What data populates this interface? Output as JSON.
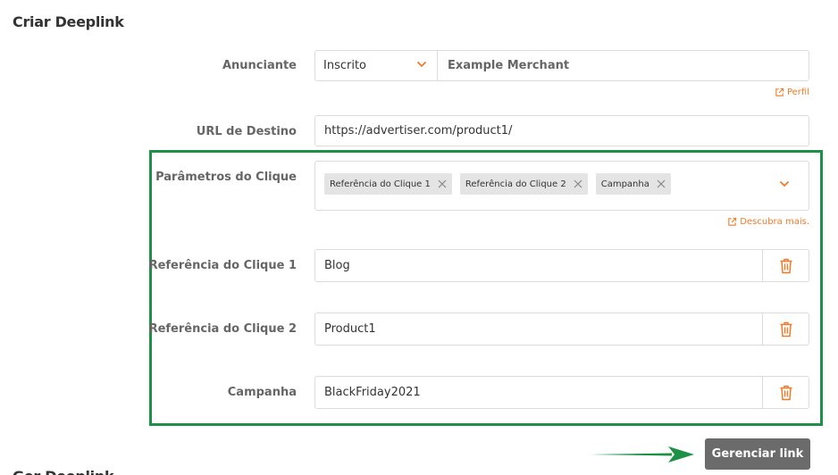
{
  "page": {
    "title": "Criar Deeplink",
    "next_section_title": "Ger Deeplink"
  },
  "advertiser": {
    "label": "Anunciante",
    "status": "Inscrito",
    "merchant": "Example Merchant",
    "profile_link": "Perfil"
  },
  "destination": {
    "label": "URL de Destino",
    "value": "https://advertiser.com/product1/"
  },
  "click_params": {
    "label": "Parâmetros do Clique",
    "chips": [
      "Referência do Clique 1",
      "Referência do Clique 2",
      "Campanha"
    ],
    "learn_more": "Descubra mais."
  },
  "params": [
    {
      "label": "Referência do Clique 1",
      "value": "Blog"
    },
    {
      "label": "Referência do Clique 2",
      "value": "Product1"
    },
    {
      "label": "Campanha",
      "value": "BlackFriday2021"
    }
  ],
  "actions": {
    "manage_link": "Gerenciar link"
  },
  "colors": {
    "accent": "#f07a2a",
    "highlight_border": "#1e9147",
    "button_bg": "#6b6b6b"
  }
}
